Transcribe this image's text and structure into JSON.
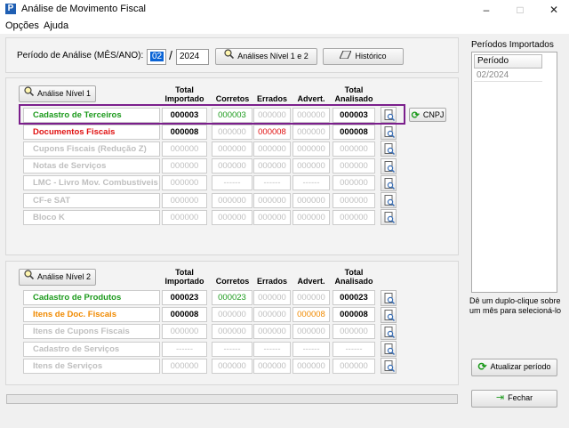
{
  "window": {
    "title": "Análise de Movimento Fiscal",
    "app_icon": "P",
    "minimize": "–",
    "maximize": "□",
    "close": "✕"
  },
  "menu": [
    "Opções",
    "Ajuda"
  ],
  "periodo": {
    "label": "Período de Análise (MÊS/ANO):",
    "month": "02",
    "separator": "/",
    "year": "2024"
  },
  "buttons": {
    "analises": "Análises Nível 1 e 2",
    "historico": "Histórico",
    "cnpj": "CNPJ",
    "atualizar": "Atualizar período",
    "fechar": "Fechar"
  },
  "headers": {
    "total_importado": [
      "Total",
      "Importado"
    ],
    "corretos": "Corretos",
    "errados": "Errados",
    "advert": "Advert.",
    "total_analisado": [
      "Total",
      "Analisado"
    ]
  },
  "nivel1": {
    "button": "Análise Nível 1",
    "rows": [
      {
        "label": "Cadastro de Terceiros",
        "color": "green",
        "values": [
          "000003",
          "000003",
          "000000",
          "000000",
          "000003"
        ],
        "colors": [
          "black",
          "green",
          "gray",
          "gray",
          "black"
        ]
      },
      {
        "label": "Documentos Fiscais",
        "color": "red",
        "values": [
          "000008",
          "000000",
          "000008",
          "000000",
          "000008"
        ],
        "colors": [
          "black",
          "gray",
          "red",
          "gray",
          "black"
        ]
      },
      {
        "label": "Cupons Fiscais (Redução Z)",
        "color": "gray",
        "values": [
          "000000",
          "000000",
          "000000",
          "000000",
          "000000"
        ],
        "colors": [
          "gray",
          "gray",
          "gray",
          "gray",
          "gray"
        ]
      },
      {
        "label": "Notas de Serviços",
        "color": "gray",
        "values": [
          "000000",
          "000000",
          "000000",
          "000000",
          "000000"
        ],
        "colors": [
          "gray",
          "gray",
          "gray",
          "gray",
          "gray"
        ]
      },
      {
        "label": "LMC - Livro Mov. Combustíveis",
        "color": "gray",
        "values": [
          "000000",
          "------",
          "------",
          "------",
          "000000"
        ],
        "colors": [
          "gray",
          "gray",
          "gray",
          "gray",
          "gray"
        ]
      },
      {
        "label": "CF-e SAT",
        "color": "gray",
        "values": [
          "000000",
          "000000",
          "000000",
          "000000",
          "000000"
        ],
        "colors": [
          "gray",
          "gray",
          "gray",
          "gray",
          "gray"
        ]
      },
      {
        "label": "Bloco K",
        "color": "gray",
        "values": [
          "000000",
          "000000",
          "000000",
          "000000",
          "000000"
        ],
        "colors": [
          "gray",
          "gray",
          "gray",
          "gray",
          "gray"
        ]
      }
    ]
  },
  "nivel2": {
    "button": "Análise Nível 2",
    "rows": [
      {
        "label": "Cadastro de Produtos",
        "color": "green",
        "values": [
          "000023",
          "000023",
          "000000",
          "000000",
          "000023"
        ],
        "colors": [
          "black",
          "green",
          "gray",
          "gray",
          "black"
        ]
      },
      {
        "label": "Itens de Doc. Fiscais",
        "color": "orange",
        "values": [
          "000008",
          "000000",
          "000000",
          "000008",
          "000008"
        ],
        "colors": [
          "black",
          "gray",
          "gray",
          "orange",
          "black"
        ]
      },
      {
        "label": "Itens de Cupons Fiscais",
        "color": "gray",
        "values": [
          "000000",
          "000000",
          "000000",
          "000000",
          "000000"
        ],
        "colors": [
          "gray",
          "gray",
          "gray",
          "gray",
          "gray"
        ]
      },
      {
        "label": "Cadastro de Serviços",
        "color": "gray",
        "values": [
          "------",
          "------",
          "------",
          "------",
          "------"
        ],
        "colors": [
          "gray",
          "gray",
          "gray",
          "gray",
          "gray"
        ]
      },
      {
        "label": "Itens de Serviços",
        "color": "gray",
        "values": [
          "000000",
          "000000",
          "000000",
          "000000",
          "000000"
        ],
        "colors": [
          "gray",
          "gray",
          "gray",
          "gray",
          "gray"
        ]
      }
    ]
  },
  "periodos": {
    "title": "Períodos Importados",
    "column": "Período",
    "items": [
      "02/2024"
    ],
    "hint": "Dê um duplo-clique sobre um mês para selecioná-lo"
  },
  "colors": {
    "green": "#1c9a1c",
    "red": "#e01010",
    "orange": "#f08a00",
    "gray": "#bfbfbf",
    "highlight": "#7b1f8c"
  }
}
